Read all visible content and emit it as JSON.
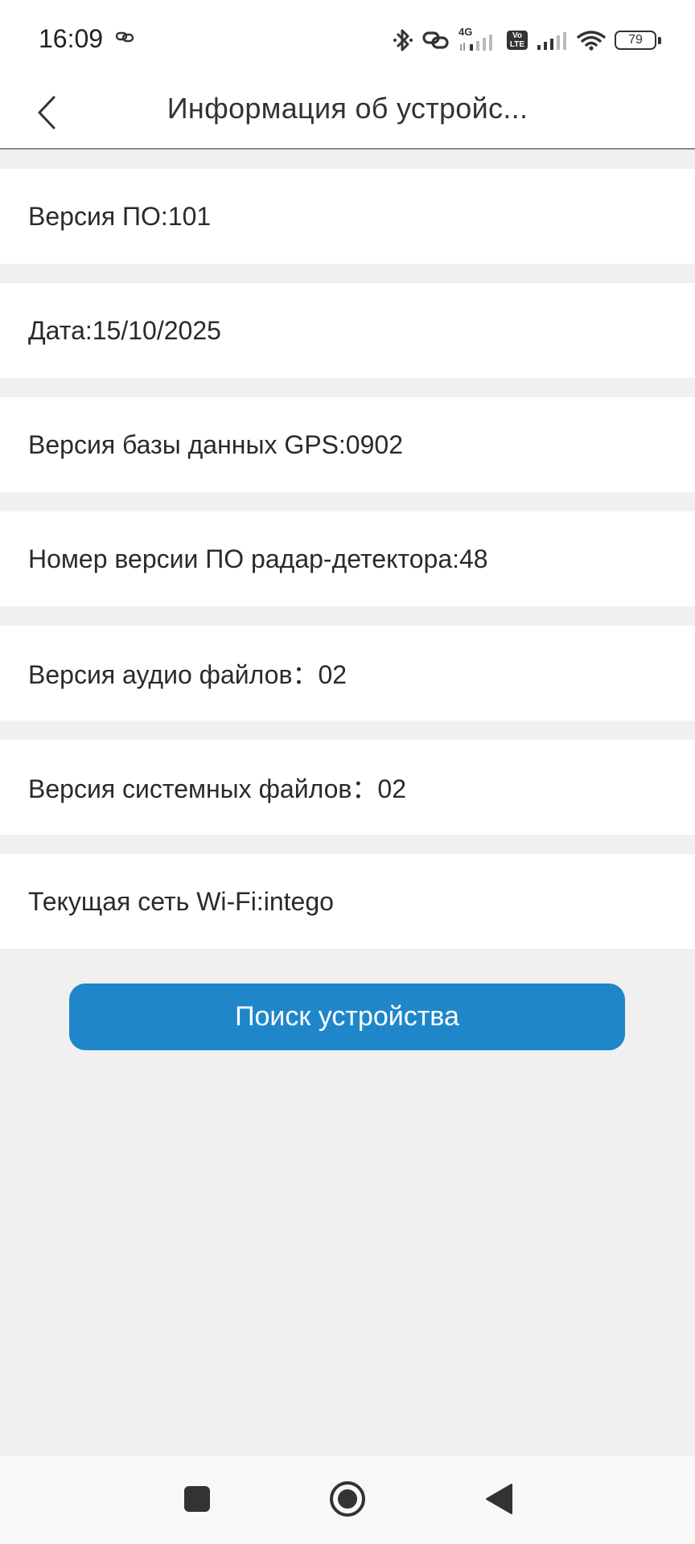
{
  "status_bar": {
    "time": "16:09",
    "network_label": "4G",
    "volte_line1": "Vo",
    "volte_line2": "LTE",
    "battery": "79",
    "icons": [
      "link-icon",
      "bluetooth-icon",
      "hotspot-link-icon",
      "signal-icon",
      "volte-icon",
      "wifi-icon",
      "battery-icon"
    ]
  },
  "header": {
    "title": "Информация об устройс...",
    "back_icon": "chevron-left-icon"
  },
  "info_rows": [
    "Версия ПО:101",
    "Дата:15/10/2025",
    "Версия базы данных GPS:0902",
    "Номер версии ПО радар-детектора:48",
    "Версия аудио файлов：02",
    "Версия системных файлов：02",
    "Текущая сеть Wi-Fi:intego"
  ],
  "search_button": {
    "label": "Поиск устройства",
    "color": "#1f87c9"
  },
  "navbar": {
    "icons": [
      "recents-square-icon",
      "home-circle-icon",
      "back-triangle-icon"
    ]
  }
}
